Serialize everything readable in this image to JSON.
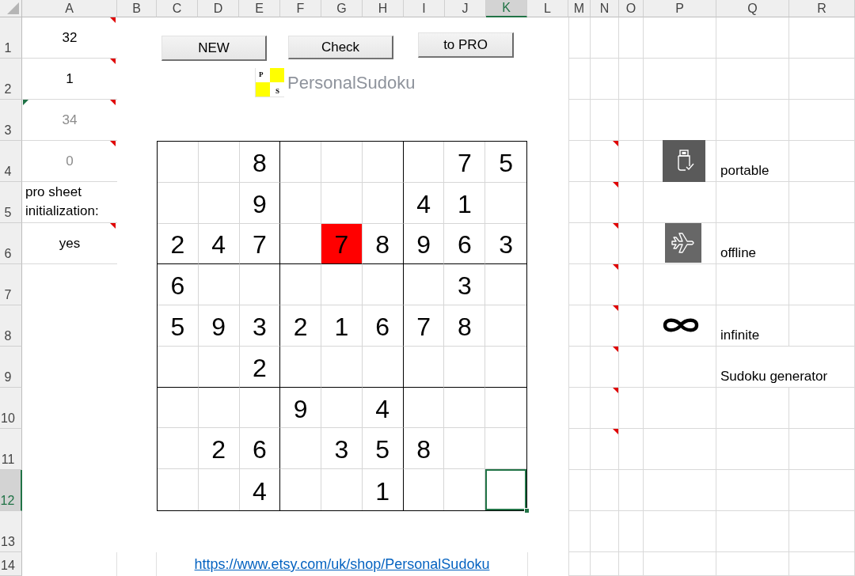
{
  "column_headers": [
    {
      "label": "A",
      "selected": false
    },
    {
      "label": "B",
      "selected": false
    },
    {
      "label": "C",
      "selected": false
    },
    {
      "label": "D",
      "selected": false
    },
    {
      "label": "E",
      "selected": false
    },
    {
      "label": "F",
      "selected": false
    },
    {
      "label": "G",
      "selected": false
    },
    {
      "label": "H",
      "selected": false
    },
    {
      "label": "I",
      "selected": false
    },
    {
      "label": "J",
      "selected": false
    },
    {
      "label": "K",
      "selected": true
    },
    {
      "label": "L",
      "selected": false
    },
    {
      "label": "M",
      "selected": false
    },
    {
      "label": "N",
      "selected": false
    },
    {
      "label": "O",
      "selected": false
    },
    {
      "label": "P",
      "selected": false
    },
    {
      "label": "Q",
      "selected": false
    },
    {
      "label": "R",
      "selected": false
    }
  ],
  "row_headers": [
    {
      "label": "1",
      "selected": false
    },
    {
      "label": "2",
      "selected": false
    },
    {
      "label": "3",
      "selected": false
    },
    {
      "label": "4",
      "selected": false
    },
    {
      "label": "5",
      "selected": false
    },
    {
      "label": "6",
      "selected": false
    },
    {
      "label": "7",
      "selected": false
    },
    {
      "label": "8",
      "selected": false
    },
    {
      "label": "9",
      "selected": false
    },
    {
      "label": "10",
      "selected": false
    },
    {
      "label": "11",
      "selected": false
    },
    {
      "label": "12",
      "selected": true
    },
    {
      "label": "13",
      "selected": false
    },
    {
      "label": "14",
      "selected": false
    }
  ],
  "column_a": [
    {
      "kind": "value",
      "text": "32",
      "dimmed": false,
      "comment": true,
      "warning": false
    },
    {
      "kind": "value",
      "text": "1",
      "dimmed": false,
      "comment": true,
      "warning": false
    },
    {
      "kind": "value",
      "text": "34",
      "dimmed": true,
      "comment": true,
      "warning": true
    },
    {
      "kind": "value",
      "text": "0",
      "dimmed": true,
      "comment": true,
      "warning": false
    },
    {
      "kind": "label",
      "text": "pro sheet initialization:",
      "dimmed": false,
      "comment": false,
      "warning": false
    },
    {
      "kind": "value",
      "text": "yes",
      "dimmed": false,
      "comment": true,
      "warning": false
    }
  ],
  "buttons": [
    {
      "label": "NEW"
    },
    {
      "label": "Check"
    },
    {
      "label": "to PRO"
    }
  ],
  "logo": {
    "letters": [
      "P",
      "S"
    ],
    "name": "PersonalSudoku"
  },
  "sudoku": {
    "rows": [
      {
        "cells": [
          {
            "error": false,
            "selected": false
          },
          {
            "error": false,
            "selected": false
          },
          {
            "value": "8",
            "error": false,
            "selected": false
          },
          {
            "error": false,
            "selected": false
          },
          {
            "error": false,
            "selected": false
          },
          {
            "error": false,
            "selected": false
          },
          {
            "error": false,
            "selected": false
          },
          {
            "value": "7",
            "error": false,
            "selected": false
          },
          {
            "value": "5",
            "error": false,
            "selected": false
          }
        ]
      },
      {
        "cells": [
          {
            "error": false,
            "selected": false
          },
          {
            "error": false,
            "selected": false
          },
          {
            "value": "9",
            "error": false,
            "selected": false
          },
          {
            "error": false,
            "selected": false
          },
          {
            "error": false,
            "selected": false
          },
          {
            "error": false,
            "selected": false
          },
          {
            "value": "4",
            "error": false,
            "selected": false
          },
          {
            "value": "1",
            "error": false,
            "selected": false
          },
          {
            "error": false,
            "selected": false
          }
        ]
      },
      {
        "cells": [
          {
            "value": "2",
            "error": false,
            "selected": false
          },
          {
            "value": "4",
            "error": false,
            "selected": false
          },
          {
            "value": "7",
            "error": false,
            "selected": false
          },
          {
            "error": false,
            "selected": false
          },
          {
            "value": "7",
            "error": true,
            "selected": false
          },
          {
            "value": "8",
            "error": false,
            "selected": false
          },
          {
            "value": "9",
            "error": false,
            "selected": false
          },
          {
            "value": "6",
            "error": false,
            "selected": false
          },
          {
            "value": "3",
            "error": false,
            "selected": false
          }
        ]
      },
      {
        "cells": [
          {
            "value": "6",
            "error": false,
            "selected": false
          },
          {
            "error": false,
            "selected": false
          },
          {
            "error": false,
            "selected": false
          },
          {
            "error": false,
            "selected": false
          },
          {
            "error": false,
            "selected": false
          },
          {
            "error": false,
            "selected": false
          },
          {
            "error": false,
            "selected": false
          },
          {
            "value": "3",
            "error": false,
            "selected": false
          },
          {
            "error": false,
            "selected": false
          }
        ]
      },
      {
        "cells": [
          {
            "value": "5",
            "error": false,
            "selected": false
          },
          {
            "value": "9",
            "error": false,
            "selected": false
          },
          {
            "value": "3",
            "error": false,
            "selected": false
          },
          {
            "value": "2",
            "error": false,
            "selected": false
          },
          {
            "value": "1",
            "error": false,
            "selected": false
          },
          {
            "value": "6",
            "error": false,
            "selected": false
          },
          {
            "value": "7",
            "error": false,
            "selected": false
          },
          {
            "value": "8",
            "error": false,
            "selected": false
          },
          {
            "error": false,
            "selected": false
          }
        ]
      },
      {
        "cells": [
          {
            "error": false,
            "selected": false
          },
          {
            "error": false,
            "selected": false
          },
          {
            "value": "2",
            "error": false,
            "selected": false
          },
          {
            "error": false,
            "selected": false
          },
          {
            "error": false,
            "selected": false
          },
          {
            "error": false,
            "selected": false
          },
          {
            "error": false,
            "selected": false
          },
          {
            "error": false,
            "selected": false
          },
          {
            "error": false,
            "selected": false
          }
        ]
      },
      {
        "cells": [
          {
            "error": false,
            "selected": false
          },
          {
            "error": false,
            "selected": false
          },
          {
            "error": false,
            "selected": false
          },
          {
            "value": "9",
            "error": false,
            "selected": false
          },
          {
            "error": false,
            "selected": false
          },
          {
            "value": "4",
            "error": false,
            "selected": false
          },
          {
            "error": false,
            "selected": false
          },
          {
            "error": false,
            "selected": false
          },
          {
            "error": false,
            "selected": false
          }
        ]
      },
      {
        "cells": [
          {
            "error": false,
            "selected": false
          },
          {
            "value": "2",
            "error": false,
            "selected": false
          },
          {
            "value": "6",
            "error": false,
            "selected": false
          },
          {
            "error": false,
            "selected": false
          },
          {
            "value": "3",
            "error": false,
            "selected": false
          },
          {
            "value": "5",
            "error": false,
            "selected": false
          },
          {
            "value": "8",
            "error": false,
            "selected": false
          },
          {
            "error": false,
            "selected": false
          },
          {
            "error": false,
            "selected": false
          }
        ]
      },
      {
        "cells": [
          {
            "error": false,
            "selected": false
          },
          {
            "error": false,
            "selected": false
          },
          {
            "value": "4",
            "error": false,
            "selected": false
          },
          {
            "error": false,
            "selected": false
          },
          {
            "error": false,
            "selected": false
          },
          {
            "value": "1",
            "error": false,
            "selected": false
          },
          {
            "error": false,
            "selected": false
          },
          {
            "error": false,
            "selected": false
          },
          {
            "error": false,
            "selected": true
          }
        ]
      }
    ]
  },
  "column_n": [
    {
      "comment": true
    },
    {
      "comment": true
    },
    {
      "comment": true
    },
    {
      "comment": true
    },
    {
      "comment": true
    },
    {
      "comment": true
    },
    {
      "comment": true
    },
    {
      "comment": true
    }
  ],
  "features": [
    {
      "kind": "drive",
      "label": "portable"
    },
    {
      "kind": "plane",
      "label": "offline"
    },
    {
      "kind": "infinity",
      "label": "infinite"
    },
    {
      "kind": "text",
      "label": "Sudoku generator"
    }
  ],
  "link": {
    "text": "https://www.etsy.com/uk/shop/PersonalSudoku"
  }
}
